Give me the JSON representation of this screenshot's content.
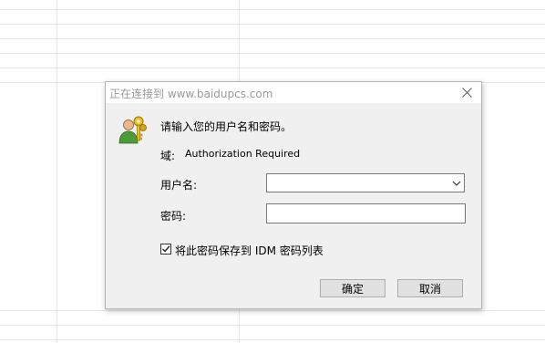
{
  "dialog": {
    "title": "正在连接到 www.baidupcs.com",
    "prompt": "请输入您的用户名和密码。",
    "domain_label": "域:",
    "domain_value": "Authorization Required",
    "username_label": "用户名:",
    "username_value": "",
    "password_label": "密码:",
    "password_value": "",
    "remember_label": "将此密码保存到 IDM 密码列表",
    "remember_checked": true,
    "ok_label": "确定",
    "cancel_label": "取消"
  },
  "icons": {
    "close": "close-icon",
    "keys": "keys-icon",
    "dropdown": "chevron-down-icon",
    "check": "checkmark-icon"
  }
}
